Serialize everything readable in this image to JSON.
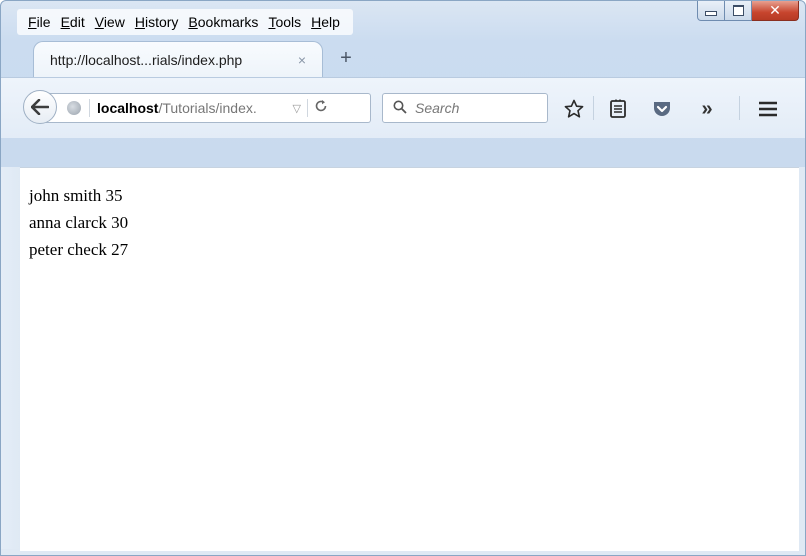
{
  "menu": {
    "items": [
      "File",
      "Edit",
      "View",
      "History",
      "Bookmarks",
      "Tools",
      "Help"
    ]
  },
  "tab": {
    "title": "http://localhost...rials/index.php",
    "close": "×",
    "new_tab": "+"
  },
  "urlbar": {
    "host": "localhost",
    "path": "/Tutorials/index."
  },
  "search": {
    "placeholder": "Search"
  },
  "toolbar": {
    "icons": [
      "back-icon",
      "globe-icon",
      "reload-icon",
      "search-icon",
      "bookmark-star-icon",
      "reading-list-icon",
      "pocket-icon",
      "overflow-chevron-icon",
      "hamburger-menu-icon"
    ]
  },
  "content": {
    "rows": [
      "john smith 35",
      "anna clarck 30",
      "peter check 27"
    ]
  },
  "colors": {
    "close_button": "#c7452e",
    "chrome": "#cbdcf0",
    "pocket": "#5a6a82"
  }
}
